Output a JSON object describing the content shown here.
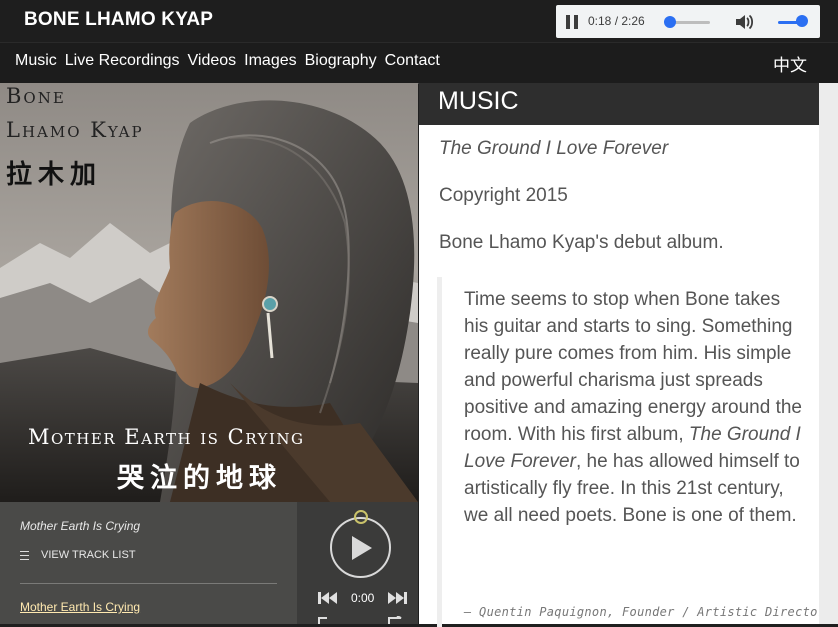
{
  "header": {
    "site_title": "BONE LHAMO KYAP"
  },
  "audio_player": {
    "time": "0:18 / 2:26",
    "progress": 0.12,
    "volume": 1.0
  },
  "nav": {
    "items": [
      {
        "label": "Music"
      },
      {
        "label": "Live Recordings"
      },
      {
        "label": "Videos"
      },
      {
        "label": "Images"
      },
      {
        "label": "Biography"
      },
      {
        "label": "Contact"
      }
    ],
    "language_label": "中文"
  },
  "album_cover": {
    "artist_line1": "Bone",
    "artist_line2": "Lhamo Kyap",
    "artist_chinese": "拉木加",
    "album_title": "Mother Earth is Crying",
    "album_title_chinese": "哭泣的地球"
  },
  "track_player": {
    "current_track": "Mother Earth Is Crying",
    "tracklist_button": "VIEW TRACK LIST",
    "track_link": "Mother Earth Is Crying",
    "time": "0:00"
  },
  "content": {
    "section_title": "MUSIC",
    "album_name": "The Ground I Love Forever",
    "copyright": "Copyright 2015",
    "description": "Bone Lhamo Kyap's debut album.",
    "quote_part1": "Time seems to stop when Bone takes his guitar and starts to sing. Something really pure comes from him. His simple and powerful charisma just spreads positive and amazing energy around the room. With his first album,",
    "quote_album": "The Ground I Love Forever",
    "quote_part2": ", he has allowed himself to artistically fly free. In this 21st century, we all need poets. Bone is one of them.",
    "quote_author": "— Quentin Paquignon, Founder / Artistic Director"
  },
  "colors": {
    "accent_blue": "#2b6ff2",
    "link_yellow": "#ffe9b0",
    "header_dark": "#1e1e1e"
  }
}
